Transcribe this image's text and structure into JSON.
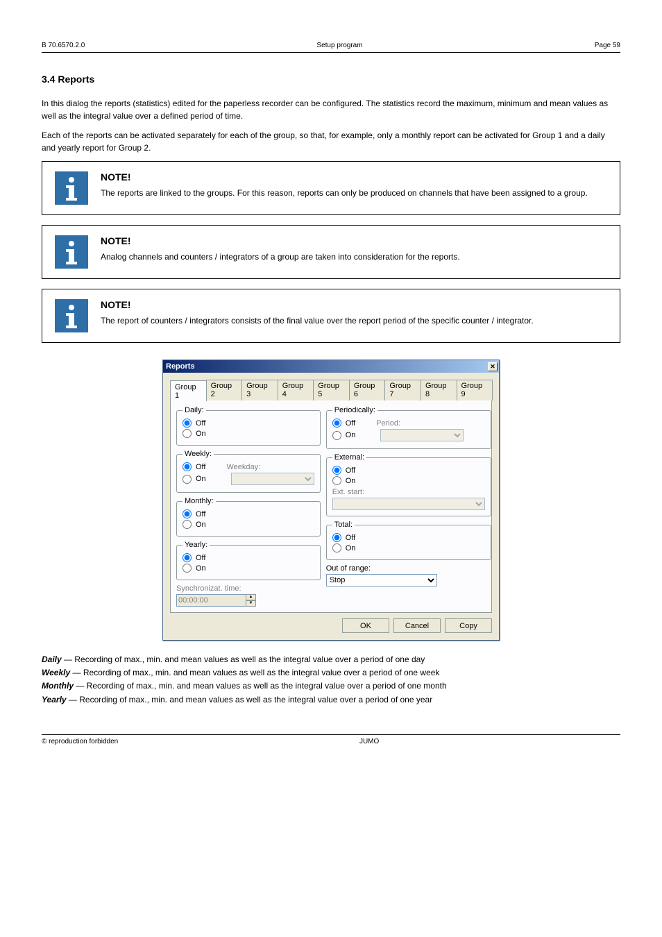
{
  "header": {
    "left": "B 70.6570.2.0",
    "center": "Setup program",
    "right": "Page 59"
  },
  "heading": "3.4 Reports",
  "paragraphs": {
    "p1": "In this dialog the reports (statistics) edited for the paperless recorder can be configured. The statistics record the maximum, minimum and mean values as well as the integral value over a defined period of time.",
    "p2": "Each of the reports can be activated separately for each of the group, so that, for example, only a monthly report can be activated for Group 1 and a daily and yearly report for Group 2."
  },
  "notes": [
    {
      "title": "NOTE!",
      "text": "The reports are linked to the groups. For this reason, reports can only be produced on channels that have been assigned to a group."
    },
    {
      "title": "NOTE!",
      "text": "Analog channels and counters / integrators of a group are taken into consideration for the reports."
    },
    {
      "title": "NOTE!",
      "text": "The report of counters / integrators consists of the final value over the report period of the specific counter / integrator."
    }
  ],
  "dialog": {
    "title": "Reports",
    "tabs": [
      "Group 1",
      "Group 2",
      "Group 3",
      "Group 4",
      "Group 5",
      "Group 6",
      "Group 7",
      "Group 8",
      "Group 9"
    ],
    "daily": {
      "legend": "Daily:",
      "off": "Off",
      "on": "On"
    },
    "weekly": {
      "legend": "Weekly:",
      "off": "Off",
      "on": "On",
      "weekdayLabel": "Weekday:"
    },
    "monthly": {
      "legend": "Monthly:",
      "off": "Off",
      "on": "On"
    },
    "yearly": {
      "legend": "Yearly:",
      "off": "Off",
      "on": "On"
    },
    "syncLabel": "Synchronizat. time:",
    "syncValue": "00:00:00",
    "periodically": {
      "legend": "Periodically:",
      "off": "Off",
      "on": "On",
      "periodLabel": "Period:"
    },
    "external": {
      "legend": "External:",
      "off": "Off",
      "on": "On",
      "extStartLabel": "Ext. start:"
    },
    "total": {
      "legend": "Total:",
      "off": "Off",
      "on": "On"
    },
    "outOfRangeLabel": "Out of range:",
    "outOfRangeValue": "Stop",
    "okLabel": "OK",
    "cancelLabel": "Cancel",
    "copyLabel": "Copy"
  },
  "fieldDesc": {
    "daily_k": "Daily",
    "daily_v": "Recording of max., min. and mean values as well as the integral value over a period of one day",
    "weekly_k": "Weekly",
    "weekly_v": "Recording of max., min. and mean values as well as the integral value over a period of one week",
    "monthly_k": "Monthly",
    "monthly_v": "Recording of max., min. and mean values as well as the integral value over a period of one month",
    "yearly_k": "Yearly",
    "yearly_v": "Recording of max., min. and mean values as well as the integral value over a period of one year"
  },
  "footer": {
    "left": "© reproduction forbidden",
    "center": "JUMO"
  }
}
